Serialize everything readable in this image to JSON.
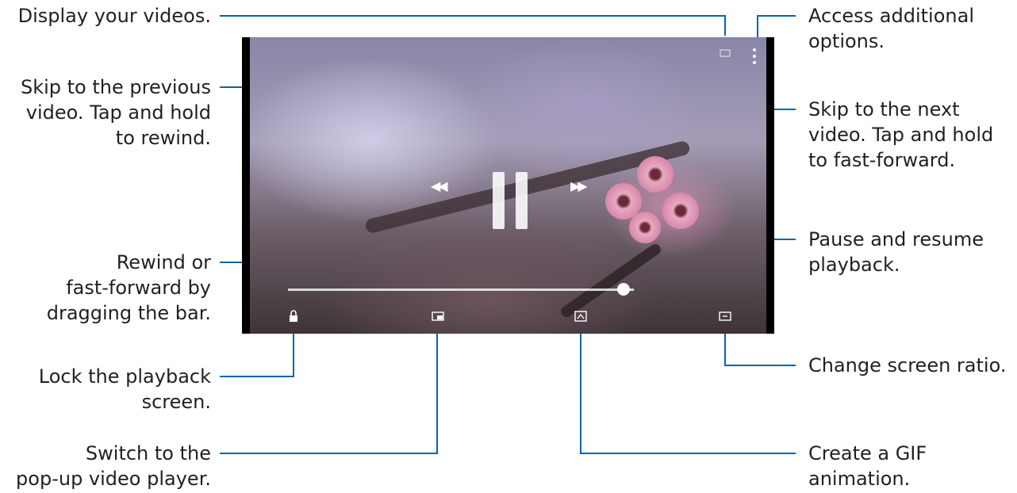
{
  "labels": {
    "display_videos": "Display your videos.",
    "access_options": "Access additional\noptions.",
    "skip_previous": "Skip to the previous\nvideo. Tap and hold\nto rewind.",
    "skip_next": "Skip to the next\nvideo. Tap and hold\nto fast-forward.",
    "pause_resume": "Pause and resume\nplayback.",
    "rewind_ff": "Rewind or\nfast-forward by\ndragging the bar.",
    "change_ratio": "Change screen ratio.",
    "lock_screen": "Lock the playback\nscreen.",
    "popup_player": "Switch to the\npop-up video player.",
    "gif": "Create a GIF\nanimation."
  },
  "player": {
    "state": "playing",
    "progress_fraction": 0.97
  },
  "colors": {
    "callout_line": "#0067a3",
    "text": "#231f20"
  },
  "icons": {
    "more": "more-options-icon",
    "previous": "skip-previous-icon",
    "next": "skip-next-icon",
    "pause": "pause-icon",
    "lock": "lock-icon",
    "popup": "popup-player-icon",
    "gif": "gif-icon",
    "ratio": "screen-ratio-icon"
  }
}
